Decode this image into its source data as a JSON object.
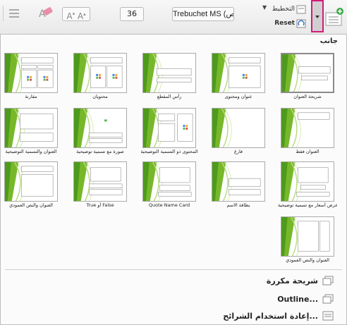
{
  "ribbon": {
    "new_slide_label": "",
    "layout_label": "التخطيط",
    "reset_label": "Reset",
    "font_name": "Trebuchet MS (نص...)",
    "font_size": "36"
  },
  "gallery": {
    "section_title": "جانب",
    "rows": [
      [
        {
          "label": "شريحة العنوان",
          "variant": "title",
          "selected": true
        },
        {
          "label": "عنوان ومحتوى",
          "variant": "title-content"
        },
        {
          "label": "رأس المقطع",
          "variant": "section"
        },
        {
          "label": "محتويان",
          "variant": "two-content"
        },
        {
          "label": "مقارنة",
          "variant": "comparison"
        }
      ],
      [
        {
          "label": "العنوان فقط",
          "variant": "title-only"
        },
        {
          "label": "فارغ",
          "variant": "blank"
        },
        {
          "label": "المحتوى ذو التسمية التوضيحية",
          "variant": "content-caption"
        },
        {
          "label": "صورة مع تسمية توضيحية",
          "variant": "picture-caption"
        },
        {
          "label": "العنوان والتسمية التوضيحية",
          "variant": "title-caption"
        }
      ],
      [
        {
          "label": "عرض أسعار مع تسمية توضيحية",
          "variant": "quote-caption"
        },
        {
          "label": "بطاقة الاسم",
          "variant": "name-card"
        },
        {
          "label": "Quote Name Card",
          "variant": "quote-name"
        },
        {
          "label": "True أو False",
          "variant": "true-false"
        },
        {
          "label": "العنوان والنص العمودي",
          "variant": "vertical-text"
        }
      ],
      [
        {
          "label": "العنوان والنص العمودي",
          "variant": "vertical-title"
        }
      ]
    ]
  },
  "menu": {
    "duplicate_label": "شريحة مكررة",
    "outline_label": "Outline...",
    "reuse_label": "إعادة استخدام الشرائح..."
  },
  "colors": {
    "accent_green": "#77b82a",
    "highlight": "#d6197a"
  },
  "icons": [
    "new-slide-icon",
    "dropdown-arrow-icon",
    "layout-icon",
    "reset-icon",
    "duplicate-icon",
    "outline-icon",
    "reuse-icon"
  ]
}
